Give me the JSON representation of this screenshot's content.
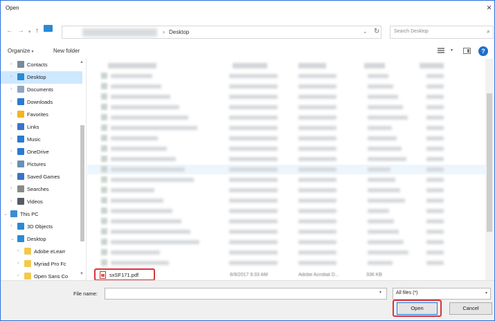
{
  "window": {
    "title": "Open",
    "close_glyph": "×"
  },
  "navigation": {
    "back_icon": "arrow-left-icon",
    "forward_icon": "arrow-right-icon",
    "recent_icon": "chevron-down-icon",
    "up_icon": "arrow-up-icon",
    "address": {
      "separator": "›",
      "current_folder": "Desktop"
    },
    "search": {
      "placeholder": "Search Desktop"
    }
  },
  "toolbar": {
    "organize_label": "Organize",
    "new_folder_label": "New folder"
  },
  "nav_pane": {
    "items": [
      {
        "label": "Contacts",
        "icon": "contacts-icon",
        "expanded": false,
        "indent": 1,
        "color": "#7a8a9a"
      },
      {
        "label": "Desktop",
        "icon": "desktop-folder-icon",
        "expanded": false,
        "indent": 1,
        "color": "#2a8ad4",
        "selected": true
      },
      {
        "label": "Documents",
        "icon": "documents-icon",
        "expanded": false,
        "indent": 1,
        "color": "#8fa6bf"
      },
      {
        "label": "Downloads",
        "icon": "downloads-icon",
        "expanded": false,
        "indent": 1,
        "color": "#2a7bd0"
      },
      {
        "label": "Favorites",
        "icon": "favorites-star-icon",
        "expanded": false,
        "indent": 1,
        "color": "#f2b51c"
      },
      {
        "label": "Links",
        "icon": "links-icon",
        "expanded": false,
        "indent": 1,
        "color": "#3a73c9"
      },
      {
        "label": "Music",
        "icon": "music-icon",
        "expanded": false,
        "indent": 1,
        "color": "#2a7bd0"
      },
      {
        "label": "OneDrive",
        "icon": "onedrive-icon",
        "expanded": false,
        "indent": 1,
        "color": "#2a7bd0"
      },
      {
        "label": "Pictures",
        "icon": "pictures-icon",
        "expanded": false,
        "indent": 1,
        "color": "#6b8fb3"
      },
      {
        "label": "Saved Games",
        "icon": "saved-games-icon",
        "expanded": false,
        "indent": 1,
        "color": "#3a73c9"
      },
      {
        "label": "Searches",
        "icon": "searches-icon",
        "expanded": false,
        "indent": 1,
        "color": "#8a8a8a"
      },
      {
        "label": "Videos",
        "icon": "videos-icon",
        "expanded": false,
        "indent": 1,
        "color": "#555c66"
      },
      {
        "label": "This PC",
        "icon": "this-pc-icon",
        "expanded": true,
        "indent": 0,
        "color": "#3a8bd6"
      },
      {
        "label": "3D Objects",
        "icon": "3d-objects-icon",
        "expanded": false,
        "indent": 1,
        "color": "#2a8ad4"
      },
      {
        "label": "Desktop",
        "icon": "desktop-folder-icon",
        "expanded": true,
        "indent": 1,
        "color": "#2a8ad4"
      },
      {
        "label": "Adobe eLearr",
        "icon": "folder-icon",
        "expanded": false,
        "indent": 2,
        "color": "#f2c94c"
      },
      {
        "label": "Myriad Pro Fc",
        "icon": "folder-icon",
        "expanded": false,
        "indent": 2,
        "color": "#f2c94c"
      },
      {
        "label": "Open Sans Co",
        "icon": "folder-icon",
        "expanded": false,
        "indent": 2,
        "color": "#f2c94c"
      }
    ]
  },
  "file_list": {
    "selected_file": {
      "name": "sxSF171.pdf",
      "icon": "pdf-file-icon",
      "date": "6/9/2017 9:33 AM",
      "type": "Adobe Acrobat D...",
      "size": "336 KB"
    }
  },
  "footer": {
    "file_name_label": "File name:",
    "file_name_value": "",
    "filter_value": "All files (*)",
    "open_label": "Open",
    "cancel_label": "Cancel"
  },
  "colors": {
    "accent": "#1e78d7",
    "highlight": "#d9343b",
    "selection": "#cde8ff"
  }
}
